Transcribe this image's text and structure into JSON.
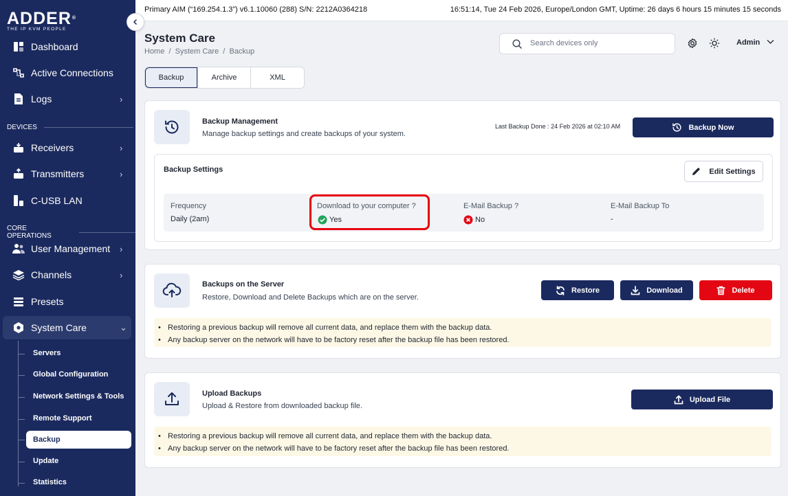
{
  "topbar": {
    "left_text": "Primary AIM (“169.254.1.3”) v6.1.10060 (288) S/N: 2212A0364218",
    "right_text": "16:51:14, Tue 24 Feb 2026, Europe/London GMT, Uptime: 26 days 6 hours 15 minutes 15 seconds"
  },
  "logo": {
    "brand": "ADDER",
    "tagline": "THE IP KVM PEOPLE",
    "trademark": "®"
  },
  "sidebar": {
    "items_top": [
      {
        "label": "Dashboard",
        "icon": "dashboard-icon"
      },
      {
        "label": "Active Connections",
        "icon": "connections-icon"
      },
      {
        "label": "Logs",
        "icon": "logs-icon",
        "chevron": "›"
      }
    ],
    "section_devices": "DEVICES",
    "items_devices": [
      {
        "label": "Receivers",
        "chevron": "›"
      },
      {
        "label": "Transmitters",
        "chevron": "›"
      },
      {
        "label": "C-USB LAN"
      }
    ],
    "section_core": "CORE OPERATIONS",
    "items_core": [
      {
        "label": "User Management",
        "chevron": "›"
      },
      {
        "label": "Channels",
        "chevron": "›"
      },
      {
        "label": "Presets"
      },
      {
        "label": "System Care",
        "chevron": "⌄"
      }
    ],
    "sub_items": [
      "Servers",
      "Global Configuration",
      "Network Settings & Tools",
      "Remote Support",
      "Backup",
      "Update",
      "Statistics"
    ],
    "active_sub": "Backup"
  },
  "header": {
    "title": "System Care",
    "breadcrumb": "Home  /  System Care  /  Backup",
    "search_placeholder": "Search devices only",
    "user": "Admin"
  },
  "tabs": [
    {
      "label": "Backup",
      "active": true
    },
    {
      "label": "Archive"
    },
    {
      "label": "XML"
    }
  ],
  "backup_management": {
    "title": "Backup Management",
    "description": "Manage backup settings and create backups of your system.",
    "last_backup_label": "Last Backup Done : ",
    "last_backup_value": "24 Feb 2026 at 02:10 AM",
    "backup_now": "Backup Now",
    "settings": {
      "title": "Backup Settings",
      "edit_button": "Edit Settings",
      "columns": [
        {
          "header": "Frequency",
          "value": "Daily (2am)"
        },
        {
          "header": "Download to your computer ?",
          "value": "Yes",
          "status": "yes"
        },
        {
          "header": "E-Mail Backup ?",
          "value": "No",
          "status": "no"
        },
        {
          "header": "E-Mail Backup To",
          "value": "-"
        }
      ]
    }
  },
  "server_backups": {
    "title": "Backups on the Server",
    "description": "Restore, Download and Delete Backups which are on the server.",
    "buttons": {
      "restore": "Restore",
      "download": "Download",
      "delete": "Delete"
    },
    "notes": [
      "Restoring a previous backup will remove all current data, and replace them with the backup data.",
      "Any backup server on the network will have to be factory reset after the backup file has been restored."
    ]
  },
  "upload_backups": {
    "title": "Upload Backups",
    "description": "Upload & Restore from downloaded backup file.",
    "button": "Upload File",
    "notes": [
      "Restoring a previous backup will remove all current data, and replace them with the backup data.",
      "Any backup server on the network will have to be factory reset after the backup file has been restored."
    ]
  },
  "colors": {
    "navy": "#1b2a5e",
    "danger": "#e30613",
    "success": "#22a45d",
    "highlight": "#e8000f",
    "note_bg": "#fdf8e6"
  }
}
